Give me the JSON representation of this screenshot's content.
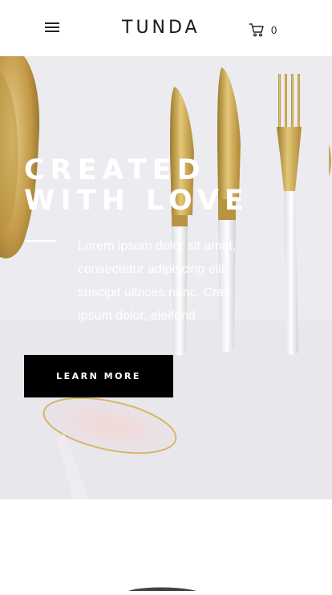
{
  "header": {
    "brand": "TUNDA",
    "cart_count": "0",
    "icons": {
      "menu": "hamburger-icon",
      "cart": "cart-icon"
    }
  },
  "hero": {
    "title_line1": "CREATED",
    "title_line2": "WITH LOVE",
    "description": "Lorem ipsum dolor sit amet, consectetur adipiscing elit. suscipit ultrices nunc. Cras ipsum dolor, eleifend",
    "cta_label": "LEARN MORE"
  },
  "colors": {
    "header_bg": "#ffffff",
    "hero_bg": "#ececf0",
    "cta_bg": "#000000",
    "hero_text": "#ffffff",
    "gold": "#c9a24a"
  }
}
